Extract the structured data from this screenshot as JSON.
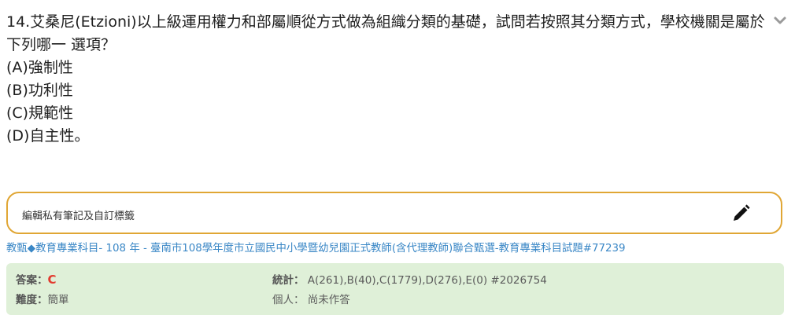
{
  "question": {
    "stem": "14.艾桑尼(Etzioni)以上級運用權力和部屬順從方式做為組織分類的基礎，試問若按照其分類方式，學校機關是屬於下列哪一 選項？",
    "options": [
      "(A)強制性",
      "(B)功利性",
      "(C)規範性",
      "(D)自主性。"
    ]
  },
  "collapse_icon": "chevron-down-icon",
  "note": {
    "label": "編輯私有筆記及自訂標籤",
    "icon": "pencil-icon",
    "border_color": "#e0a634"
  },
  "source": {
    "text": "教甄◆教育專業科目- 108 年 - 臺南市108學年度市立國民中小學暨幼兒園正式教師(含代理教師)聯合甄選-教育專業科目試題#77239"
  },
  "stats": {
    "answer_label": "答案：",
    "answer_value": "C",
    "difficulty_label": "難度：",
    "difficulty_value": "簡單",
    "stats_label": "統計：",
    "stats_value": "A(261),B(40),C(1779),D(276),E(0) #2026754",
    "personal_label": "個人：",
    "personal_value": "尚未作答",
    "background": "#dff0d8",
    "answer_color": "#e23a2e"
  }
}
